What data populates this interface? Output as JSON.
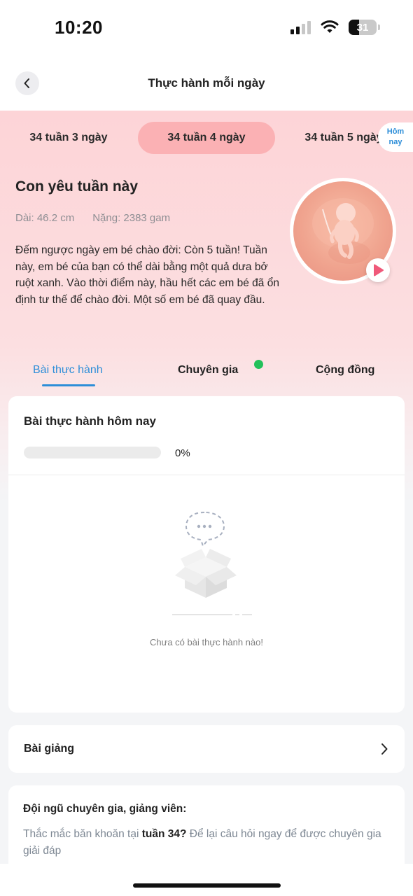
{
  "status_bar": {
    "time": "10:20",
    "battery": "31"
  },
  "header": {
    "title": "Thực hành mỗi ngày"
  },
  "week_tabs": [
    {
      "label": "34 tuần 3 ngày"
    },
    {
      "label": "34 tuần 4 ngày",
      "active": true
    },
    {
      "label": "34 tuần 5 ngày"
    }
  ],
  "today_badge": {
    "line1": "Hôm",
    "line2": "nay"
  },
  "hero": {
    "title": "Con yêu tuần này",
    "length": "Dài: 46.2 cm",
    "weight": "Nặng: 2383 gam",
    "description": "Đếm ngược ngày em bé chào đời: Còn 5 tuần! Tuần này, em bé của bạn có thể dài bằng một quả dưa bở ruột xanh. Vào thời điểm này, hầu hết các em bé đã ổn định tư thế để chào đời. Một số em bé đã quay đầu."
  },
  "section_tabs": [
    {
      "label": "Bài thực hành",
      "active": true
    },
    {
      "label": "Chuyên gia",
      "has_dot": true
    },
    {
      "label": "Cộng đồng"
    }
  ],
  "practice": {
    "title": "Bài thực hành hôm nay",
    "progress_percent": 0,
    "progress_label": "0%",
    "empty_text": "Chưa có bài thực hành nào!"
  },
  "lectures": {
    "title": "Bài giảng"
  },
  "experts": {
    "title": "Đội ngũ chuyên gia, giảng viên:",
    "desc_prefix": "Thắc mắc băn khoăn tại ",
    "desc_bold": "tuần 34?",
    "desc_suffix": " Để lại câu hỏi ngay để được chuyên gia giải đáp"
  },
  "colors": {
    "accent": "#2d8ed8",
    "active_week": "#fbb1b4",
    "play": "#f0597a",
    "dot": "#23c05a"
  }
}
